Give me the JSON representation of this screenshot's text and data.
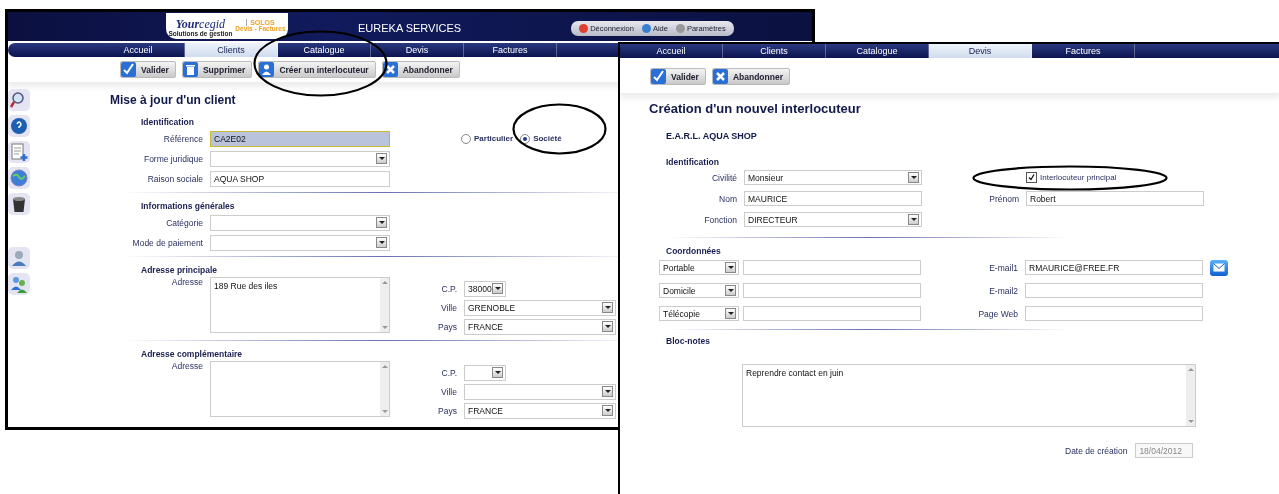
{
  "client_window": {
    "header": {
      "logo_brand_1": "Your",
      "logo_brand_2": "cegid",
      "logo_product": "SOLOS",
      "logo_tagline": "Solutions de gestion",
      "logo_subtitle": "Devis - Factures",
      "company": "EUREKA SERVICES",
      "links": [
        "Déconnexion",
        "Aide",
        "Paramètres"
      ]
    },
    "tabs": [
      {
        "label": "Accueil",
        "selected": false
      },
      {
        "label": "Clients",
        "selected": true
      },
      {
        "label": "Catalogue",
        "selected": false
      },
      {
        "label": "Devis",
        "selected": false
      },
      {
        "label": "Factures",
        "selected": false
      }
    ],
    "toolbar": [
      {
        "label": "Valider",
        "kind": "validate"
      },
      {
        "label": "Supprimer",
        "kind": "delete"
      },
      {
        "label": "Créer un interlocuteur",
        "kind": "contact"
      },
      {
        "label": "Abandonner",
        "kind": "cancel"
      }
    ],
    "title": "Mise à jour d'un client",
    "sections": [
      {
        "heading": "Identification",
        "fields": [
          {
            "label": "Référence",
            "kind": "text",
            "value": "CA2E02",
            "focused": true
          },
          {
            "label": "Forme juridique",
            "kind": "select",
            "focused": false
          },
          {
            "label": "Raison sociale",
            "kind": "text",
            "value": "AQUA SHOP",
            "focused": false
          }
        ],
        "options": [
          {
            "label": "Particulier",
            "selected": false
          },
          {
            "label": "Société",
            "selected": true
          }
        ]
      },
      {
        "heading": "Informations générales",
        "fields": [
          {
            "label": "Catégorie",
            "kind": "select",
            "focused": false
          },
          {
            "label": "Mode de paiement",
            "kind": "select",
            "focused": false
          }
        ]
      },
      {
        "heading": "Adresse principale",
        "fields": [
          {
            "label": "Adresse",
            "kind": "textarea",
            "value": "189 Rue des iles",
            "focused": false
          }
        ],
        "side_fields": [
          {
            "label": "C.P.",
            "kind": "short_select",
            "value": "38000",
            "focused": false
          },
          {
            "label": "Ville",
            "kind": "select",
            "value": "GRENOBLE",
            "focused": false
          },
          {
            "label": "Pays",
            "kind": "select",
            "value": "FRANCE",
            "focused": false
          }
        ]
      },
      {
        "heading": "Adresse complémentaire",
        "fields": [
          {
            "label": "Adresse",
            "kind": "textarea",
            "focused": false
          }
        ],
        "side_fields": [
          {
            "label": "C.P.",
            "kind": "short_select",
            "focused": false
          },
          {
            "label": "Ville",
            "kind": "select",
            "focused": false
          },
          {
            "label": "Pays",
            "kind": "select",
            "value": "FRANCE",
            "focused": false
          }
        ]
      }
    ]
  },
  "contact_window": {
    "tabs": [
      {
        "label": "Accueil",
        "selected": false
      },
      {
        "label": "Clients",
        "selected": false
      },
      {
        "label": "Catalogue",
        "selected": false
      },
      {
        "label": "Devis",
        "selected": true
      },
      {
        "label": "Factures",
        "selected": false
      }
    ],
    "toolbar": [
      {
        "label": "Valider",
        "kind": "validate"
      },
      {
        "label": "Abandonner",
        "kind": "cancel"
      }
    ],
    "title": "Création d'un nouvel interlocuteur",
    "company": "E.A.R.L. AQUA SHOP",
    "identification": {
      "heading": "Identification",
      "civility": {
        "label": "Civilité",
        "value": "Monsieur"
      },
      "main_contact": {
        "label": "Interlocuteur principal",
        "checked": true
      },
      "last_name": {
        "label": "Nom",
        "value": "MAURICE"
      },
      "first_name": {
        "label": "Prénom",
        "value": "Robert"
      },
      "function": {
        "label": "Fonction",
        "value": "DIRECTEUR"
      }
    },
    "contact_details": {
      "heading": "Coordonnées",
      "rows": [
        {
          "phone_type": "Portable",
          "right_label": "E-mail1",
          "right_value": "RMAURICE@FREE.FR",
          "kind": "email"
        },
        {
          "phone_type": "Domicile",
          "right_label": "E-mail2",
          "kind": "plain"
        },
        {
          "phone_type": "Télécopie",
          "right_label": "Page Web",
          "kind": "plain"
        }
      ]
    },
    "notes": {
      "heading": "Bloc-notes",
      "value": "Reprendre contact en juin"
    },
    "created": {
      "label": "Date de création",
      "value": "18/04/2012",
      "disabled": true
    }
  }
}
